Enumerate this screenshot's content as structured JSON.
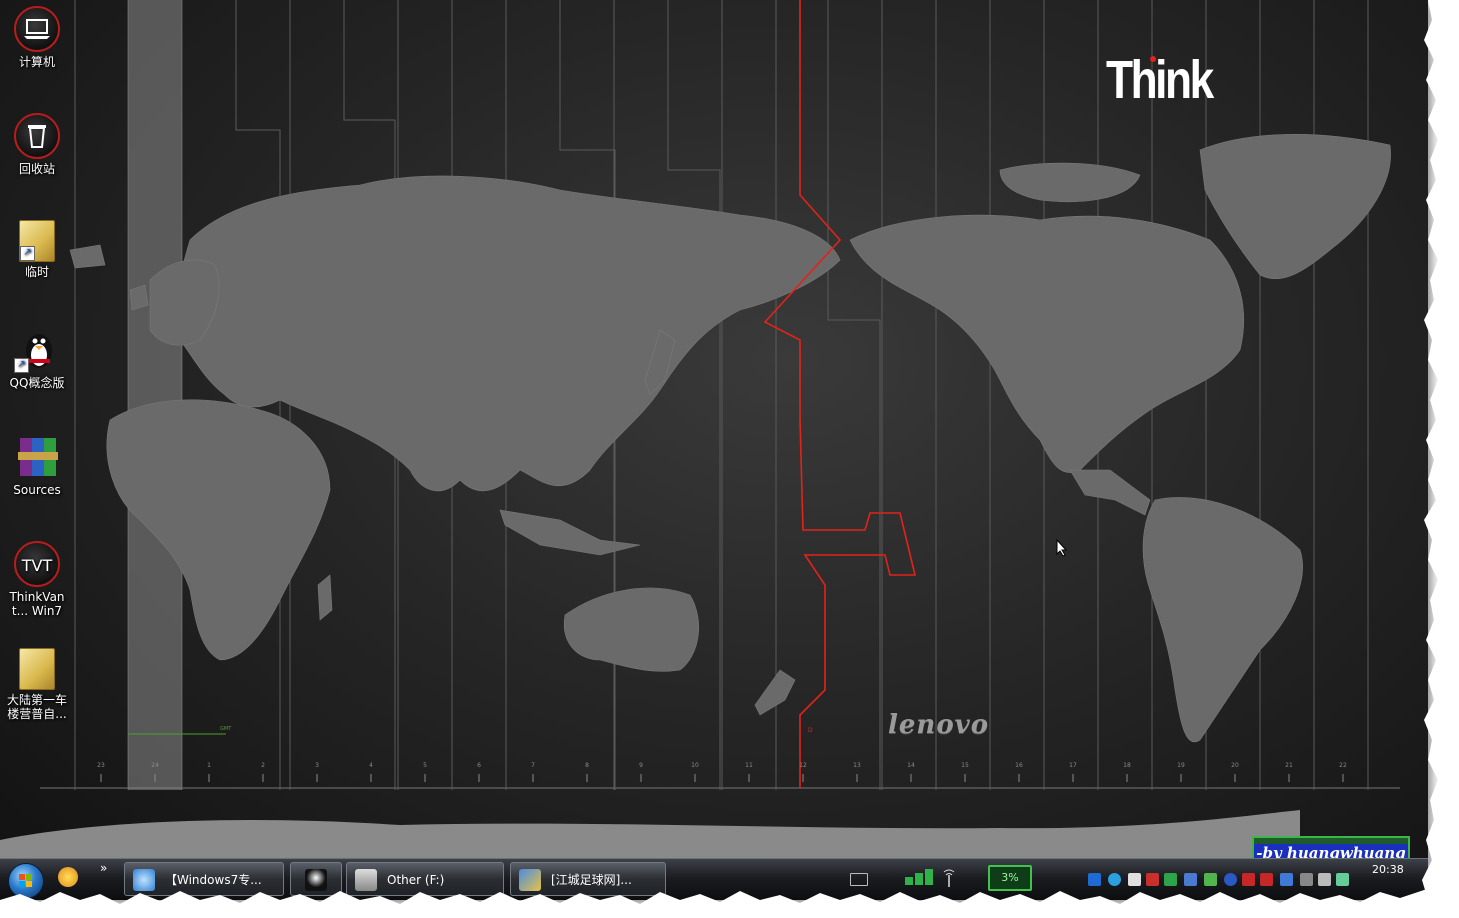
{
  "desktop": {
    "icons": [
      {
        "label": "计算机",
        "icon": "computer-icon"
      },
      {
        "label": "回收站",
        "icon": "recycle-bin-icon"
      },
      {
        "label": "临时",
        "icon": "folder-icon"
      },
      {
        "label": "QQ概念版",
        "icon": "qq-penguin-icon"
      },
      {
        "label": "Sources",
        "icon": "winrar-books-icon"
      },
      {
        "label": "ThinkVant... Win7",
        "icon": "tvt-icon"
      },
      {
        "label": "大陆第一车 楼营普自...",
        "icon": "folder-icon"
      }
    ],
    "wallpaper": {
      "brand": "Think",
      "maker": "lenovo",
      "gmt_label": "GMT",
      "dateline_label": "D",
      "timezones": [
        "23",
        "24",
        "1",
        "2",
        "3",
        "4",
        "5",
        "6",
        "7",
        "8",
        "9",
        "10",
        "11",
        "12",
        "13",
        "14",
        "15",
        "16",
        "17",
        "18",
        "19",
        "20",
        "21",
        "22"
      ],
      "accent_color": "#e2231a"
    },
    "signature": "-by huangwhuang"
  },
  "taskbar": {
    "more_label": "»",
    "buttons": [
      {
        "label": "【Windows7专..."
      },
      {
        "label": ""
      },
      {
        "label": "Other (F:)"
      },
      {
        "label": "[江城足球网]..."
      }
    ],
    "tray_block": "3%",
    "clock": "20:38"
  }
}
